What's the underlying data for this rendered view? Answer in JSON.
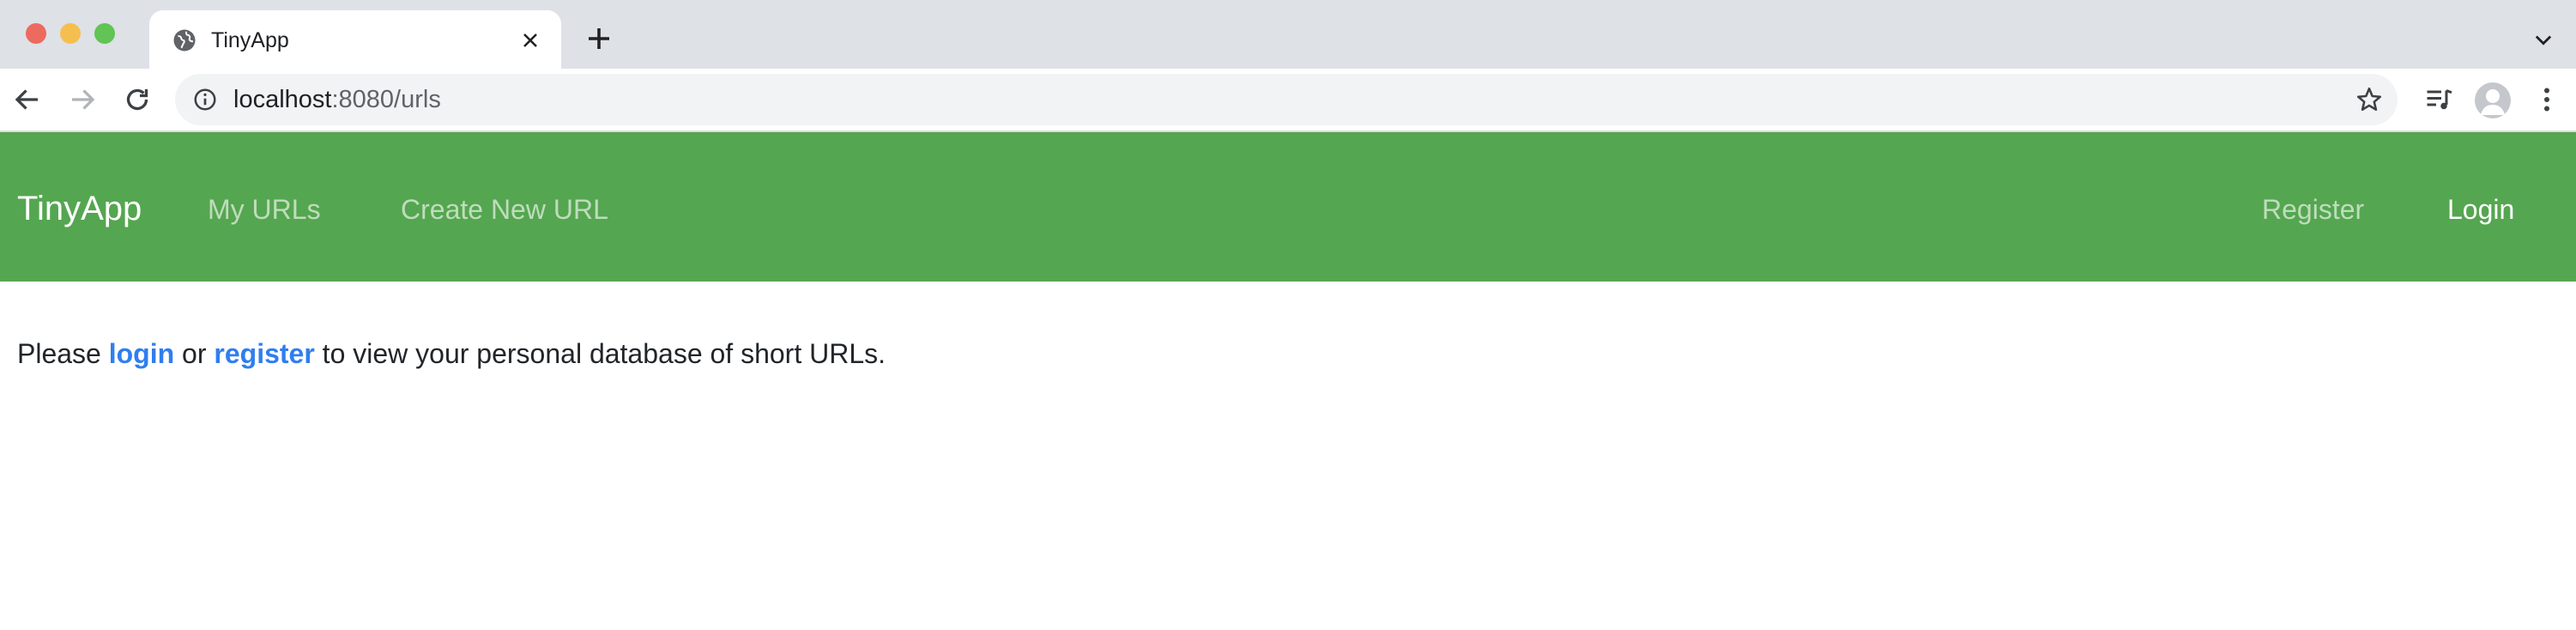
{
  "browser": {
    "tab": {
      "title": "TinyApp"
    },
    "address": {
      "host": "localhost",
      "rest": ":8080/urls"
    },
    "icons": [
      "globe-icon",
      "close-icon",
      "plus-icon",
      "chevron-down-icon",
      "back-arrow-icon",
      "forward-arrow-icon",
      "reload-icon",
      "info-icon",
      "star-icon",
      "media-queue-icon",
      "profile-avatar-icon",
      "more-vertical-icon"
    ]
  },
  "navbar": {
    "brand": "TinyApp",
    "links": [
      {
        "label": "My URLs"
      },
      {
        "label": "Create New URL"
      }
    ],
    "right_links": [
      {
        "label": "Register"
      },
      {
        "label": "Login"
      }
    ],
    "colors": {
      "background": "#55a650",
      "link": "#c6e3c3",
      "link_active": "#ffffff"
    }
  },
  "content": {
    "prefix": "Please",
    "login_link": "login",
    "middle": "or",
    "register_link": "register",
    "suffix": "to view your personal database of short URLs.",
    "link_color": "#2f7ef0"
  }
}
